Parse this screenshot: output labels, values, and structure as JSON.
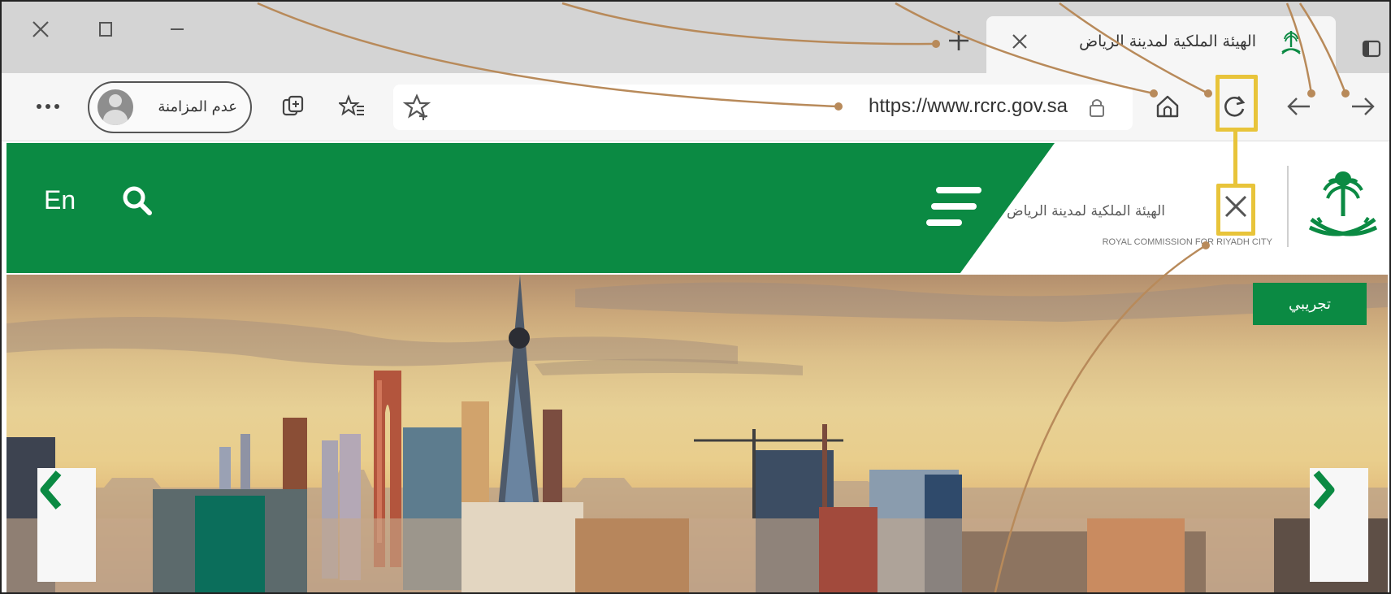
{
  "browser": {
    "tab": {
      "title": "الهيئة الملكية لمدينة الرياض"
    },
    "address_bar": {
      "url": "https://www.rcrc.gov.sa"
    },
    "profile": {
      "label": "عدم المزامنة"
    }
  },
  "site": {
    "language_toggle": "En",
    "org_name_ar": "الهيئة الملكية لمدينة الرياض",
    "org_name_en": "ROYAL COMMISSION FOR RIYADH CITY",
    "badge": "تجريبي"
  },
  "colors": {
    "brand_green": "#0b8a43",
    "highlight": "#e8c43a",
    "callout_line": "#b88a5a"
  },
  "icons": [
    "close-icon",
    "restore-icon",
    "minimize-icon",
    "new-tab-icon",
    "tabs-menu-icon",
    "back-icon",
    "forward-icon",
    "refresh-icon",
    "home-icon",
    "lock-icon",
    "favorite-star-icon",
    "favorites-icon",
    "collections-icon",
    "more-icon",
    "search-icon",
    "menu-icon",
    "chevron-left-icon",
    "chevron-right-icon"
  ]
}
